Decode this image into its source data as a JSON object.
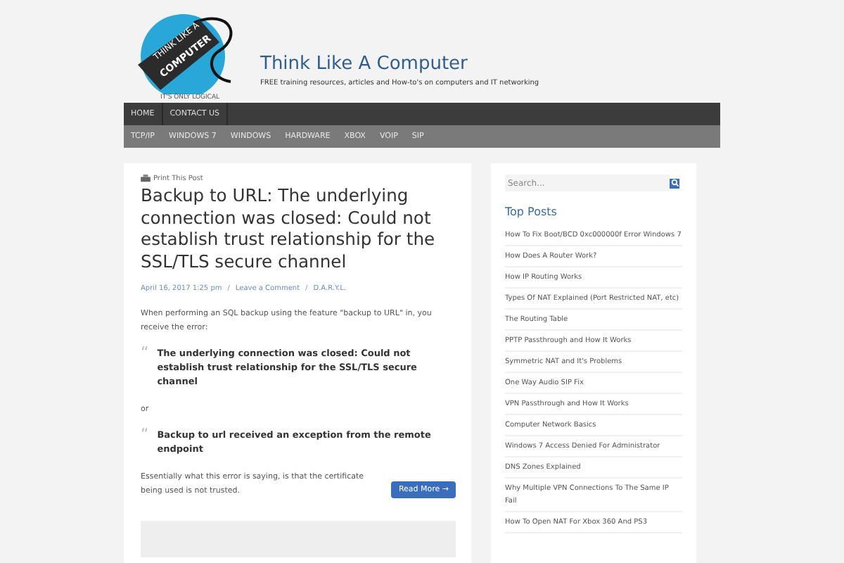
{
  "logo": {
    "line_1": "THINK LIKE A",
    "line_2": "COMPUTER",
    "tagline": "IT'S ONLY LOGICAL"
  },
  "site": {
    "title": "Think Like A Computer",
    "description": "FREE training resources, articles and How-to's on computers and IT networking"
  },
  "main_nav": [
    "HOME",
    "CONTACT US"
  ],
  "sub_nav": [
    "TCP/IP",
    "WINDOWS 7",
    "WINDOWS",
    "HARDWARE",
    "XBOX",
    "VOIP",
    "SIP"
  ],
  "post": {
    "print_link": "Print This Post",
    "title": "Backup to URL: The underlying connection was closed: Could not establish trust relationship for the SSL/TLS secure channel",
    "meta": [
      "April 16, 2017 1:25 pm",
      "Leave a Comment",
      "D.A.R.Y.L."
    ],
    "meta_separator": "/",
    "quote_mark": "“",
    "content": [
      {
        "kind": "paragraph",
        "text": "When performing an SQL backup using the feature \"backup to URL\" in, you receive the error:"
      },
      {
        "kind": "quote",
        "text": "The underlying connection was closed: Could not establish trust relationship for the SSL/TLS secure channel"
      },
      {
        "kind": "paragraph",
        "text": "or"
      },
      {
        "kind": "quote",
        "text": "Backup to url received an exception from the remote endpoint"
      },
      {
        "kind": "paragraph",
        "text": "Essentially what this error is saying, is that the certificate being used is not trusted.",
        "button": "Read More →"
      }
    ]
  },
  "sidebar": {
    "search": {
      "placeholder": "Search..."
    },
    "heading": "Top Posts",
    "posts": [
      "How To Fix Boot/BCD 0xc000000f Error Windows 7",
      "How Does A Router Work?",
      "How IP Routing Works",
      "Types Of NAT Explained (Port Restricted NAT, etc)",
      "The Routing Table",
      "PPTP Passthrough and How It Works",
      "Symmetric NAT and It's Problems",
      "One Way Audio SIP Fix",
      "VPN Passthrough and How It Works",
      "Computer Network Basics",
      "Windows 7 Access Denied For Administrator",
      "DNS Zones Explained",
      "Why Multiple VPN Connections To The Same IP Fail",
      "How To Open NAT For Xbox 360 And PS3"
    ]
  }
}
